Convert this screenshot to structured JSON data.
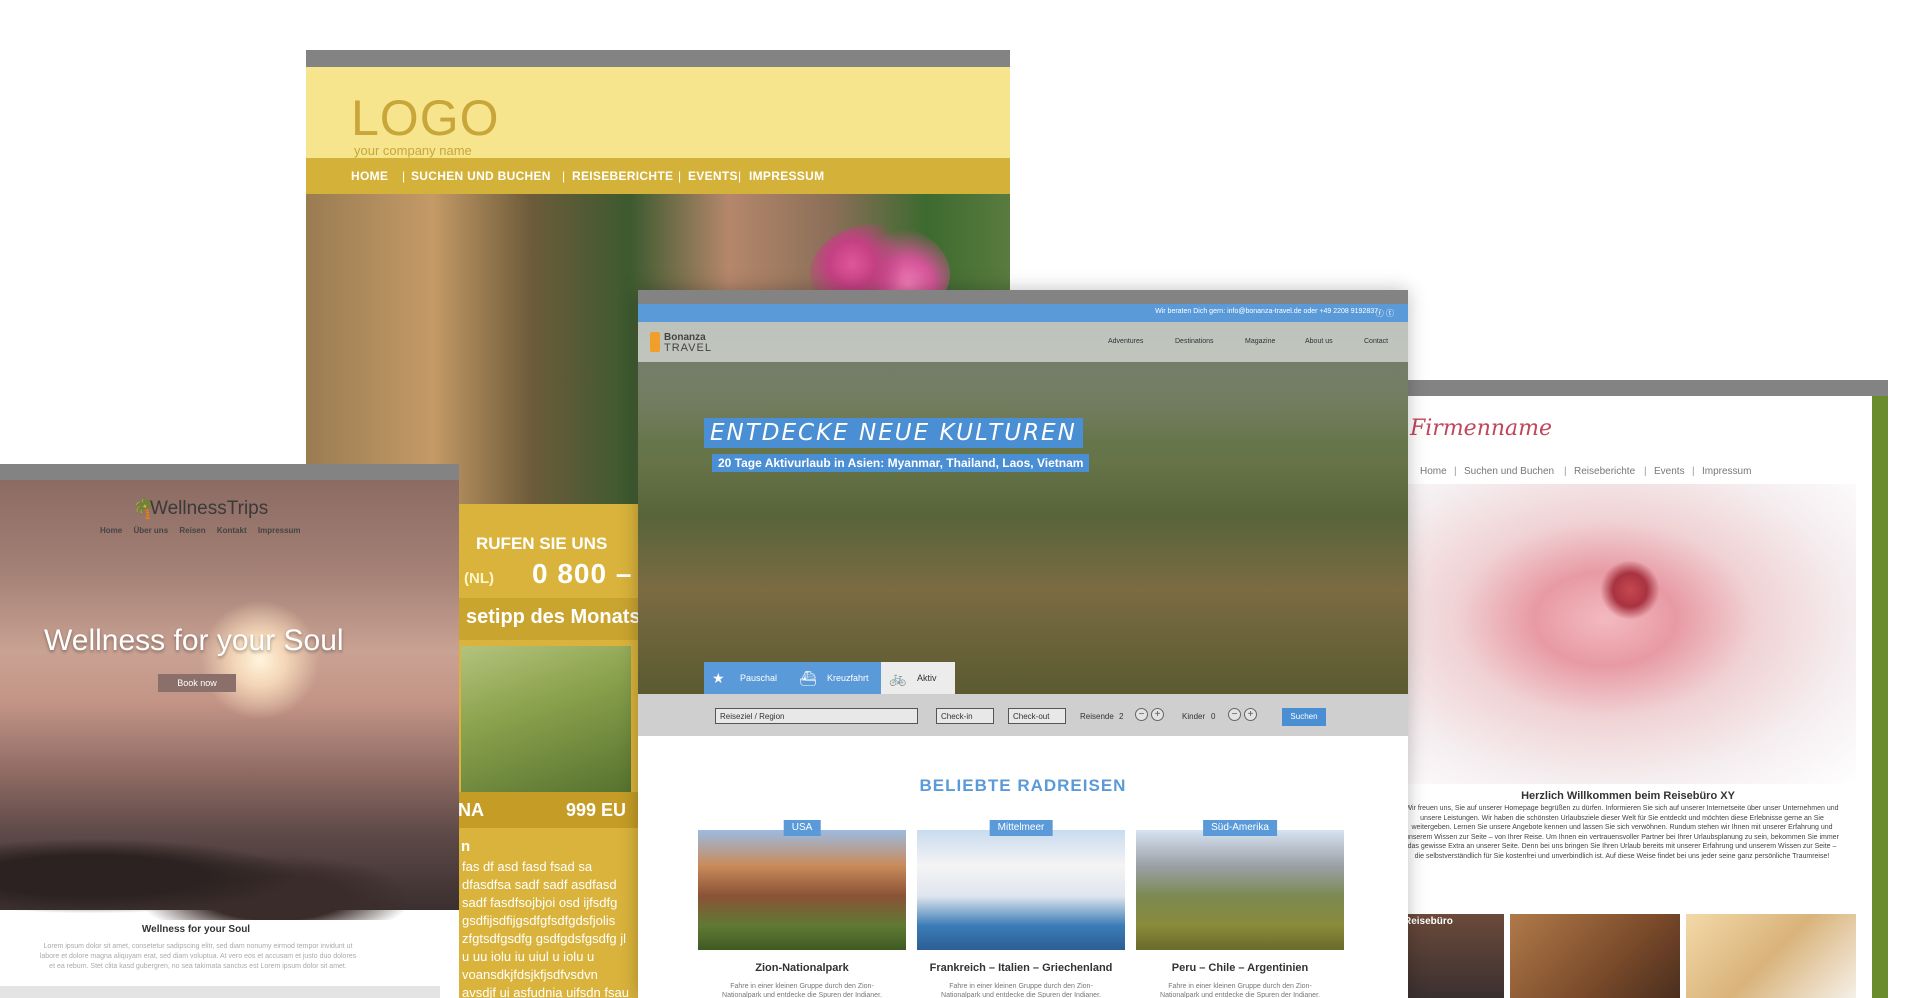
{
  "yellow": {
    "logo": "LOGO",
    "tagline": "your company name",
    "nav": [
      "HOME",
      "SUCHEN UND BUCHEN",
      "REISEBERICHTE",
      "EVENTS",
      "IMPRESSUM"
    ],
    "separator": "|",
    "call": "RUFEN SIE UNS",
    "nl": "(NL)",
    "phone": "0 800 –",
    "tip": "setipp des Monats",
    "price_left": "NA",
    "price": "999 EU",
    "letter": "n",
    "paragraph": "fas df asd fasd fsad sa dfasdfsa sadf sadf asdfasd sadf fasdfsojbjoi osd ijfsdfg gsdfijsdfijgsdfgfsdfgdsfjolis zfgtsdfgsdfg gsdfgdsfgsdfg jl u uu iolu iu uiul u iolu u voansdkjfdsjkfjsdfvsdvn avsdjf ui asfudnia uifsdn fsau"
  },
  "wellness": {
    "brand": "WellnessTrips",
    "brand_icon": "palm-tree-icon",
    "menu": [
      "Home",
      "Über uns",
      "Reisen",
      "Kontakt",
      "Impressum"
    ],
    "hero_title": "Wellness for your Soul",
    "button": "Book now",
    "sub_title": "Wellness for your Soul",
    "lorem": "Lorem ipsum dolor sit amet, consetetur sadipscing elitr, sed diam nonumy eirmod tempor invidunt ut labore et dolore magna aliquyam erat, sed diam voluptua. At vero eos et accusam et justo duo dolores et ea rebum. Stet clita kasd gubergren, no sea takimata sanctus est Lorem ipsum dolor sit amet."
  },
  "bonanza": {
    "topbar_contact": "Wir beraten Dich gern:   info@bonanza-travel.de   oder   +49 2208 9192837",
    "social_icons": [
      "facebook-icon",
      "twitter-icon"
    ],
    "brand_line1": "Bonanza",
    "brand_line2": "TRAVEL",
    "nav": [
      "Adventures",
      "Destinations",
      "Magazine",
      "About us",
      "Contact"
    ],
    "headline": "ENTDECKE NEUE KULTUREN",
    "subline": "20 Tage Aktivurlaub in Asien: Myanmar, Thailand, Laos, Vietnam",
    "tabs": [
      {
        "label": "Pauschal",
        "icon": "star-icon"
      },
      {
        "label": "Kreuzfahrt",
        "icon": "ship-icon"
      },
      {
        "label": "Aktiv",
        "icon": "bicycle-icon"
      }
    ],
    "search": {
      "destination": "Reiseziel / Region",
      "checkin": "Check-in",
      "checkout": "Check-out",
      "travelers_label": "Reisende",
      "travelers": "2",
      "kids_label": "Kinder",
      "kids": "0",
      "minus": "−",
      "plus": "+",
      "button": "Suchen"
    },
    "section_title": "BELIEBTE RADREISEN",
    "tours": [
      {
        "badge": "USA",
        "name": "Zion-Nationalpark",
        "desc": "Fahre in einer kleinen Gruppe durch den Zion-Nationalpark und entdecke die Spuren der Indianer."
      },
      {
        "badge": "Mittelmeer",
        "name": "Frankreich – Italien – Griechenland",
        "desc": "Fahre in einer kleinen Gruppe durch den Zion-Nationalpark und entdecke die Spuren der Indianer."
      },
      {
        "badge": "Süd-Amerika",
        "name": "Peru – Chile – Argentinien",
        "desc": "Fahre in einer kleinen Gruppe durch den Zion-Nationalpark und entdecke die Spuren der Indianer."
      }
    ]
  },
  "firma": {
    "brand": "Firmenname",
    "nav": [
      "Home",
      "Suchen und Buchen",
      "Reiseberichte",
      "Events",
      "Impressum"
    ],
    "separator": "|",
    "welcome": "Herzlich Willkommen beim Reisebüro XY",
    "text": "Wir freuen uns, Sie auf unserer Homepage begrüßen zu dürfen. Informieren Sie sich auf unserer Internetseite über unser Unternehmen und unsere Leistungen. Wir haben die schönsten Urlaubsziele dieser Welt für Sie entdeckt und möchten diese Erlebnisse gerne an Sie weitergeben. Lernen Sie unsere Angebote kennen und lassen Sie sich verwöhnen. Rundum stehen wir Ihnen mit unserer Erfahrung und unserem Wissen zur Seite – von Ihrer Reise. Um Ihnen ein vertrauensvoller Partner bei Ihrer Urlaubsplanung zu sein, bekommen Sie immer das gewisse Extra an unserer Seite. Denn bei uns bringen Sie Ihren Urlaub bereits mit unserer Erfahrung und unserem Wissen zur Seite – die selbstverständlich für Sie kostenfrei und unverbindlich ist. Auf diese Weise findet bei uns jeder seine ganz persönliche Traumreise!",
    "thumb_label": "Reisebüro"
  }
}
